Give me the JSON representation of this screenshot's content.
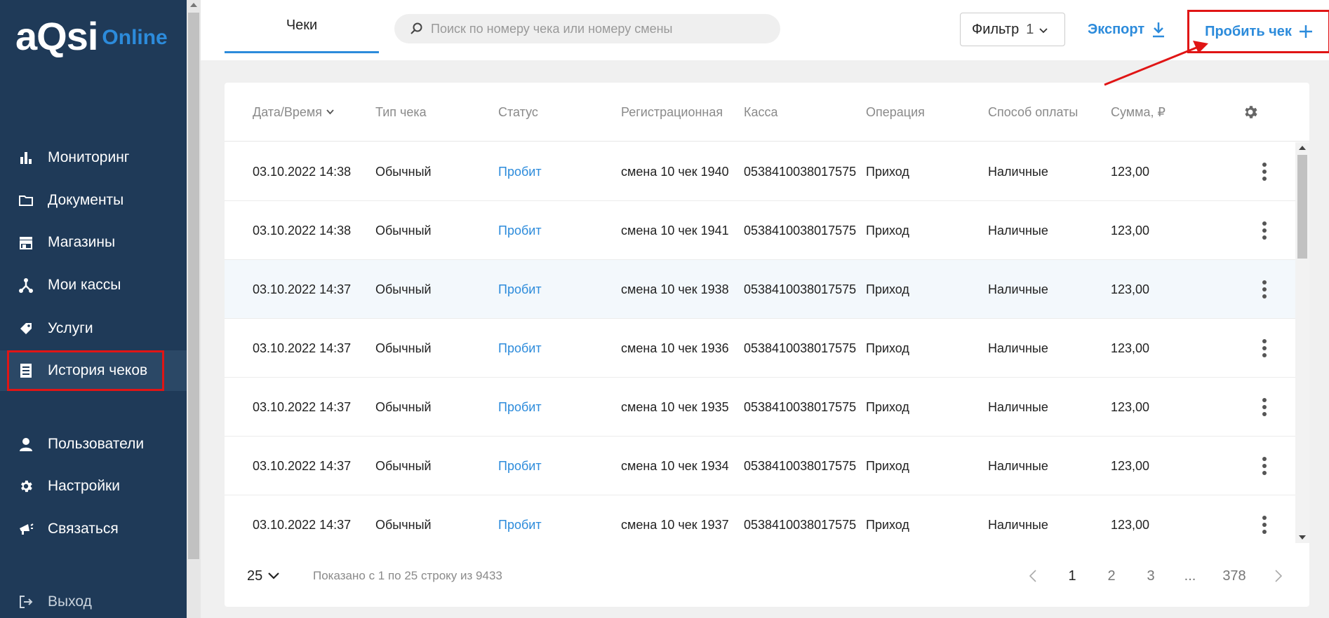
{
  "sidebar": {
    "logo_main": "aQsi",
    "logo_sub": "Online",
    "items": [
      {
        "label": "Мониторинг"
      },
      {
        "label": "Документы"
      },
      {
        "label": "Магазины"
      },
      {
        "label": "Мои кассы"
      },
      {
        "label": "Услуги"
      },
      {
        "label": "История чеков"
      },
      {
        "label": "Пользователи"
      },
      {
        "label": "Настройки"
      },
      {
        "label": "Связаться"
      },
      {
        "label": "Выход"
      }
    ]
  },
  "topbar": {
    "tab_label": "Чеки",
    "search_placeholder": "Поиск по номеру чека или номеру смены",
    "filter_label": "Фильтр",
    "filter_count": "1",
    "export_label": "Экспорт",
    "print_label": "Пробить чек"
  },
  "table": {
    "headers": [
      "Дата/Время",
      "Тип чека",
      "Статус",
      "Регистрационная",
      "Касса",
      "Операция",
      "Способ оплаты",
      "Сумма, ₽"
    ],
    "rows": [
      {
        "datetime": "03.10.2022 14:38",
        "type": "Обычный",
        "status": "Пробит",
        "reg": "смена 10 чек 1940",
        "kassa": "0538410038017575",
        "op": "Приход",
        "pay": "Наличные",
        "sum": "123,00"
      },
      {
        "datetime": "03.10.2022 14:38",
        "type": "Обычный",
        "status": "Пробит",
        "reg": "смена 10 чек 1941",
        "kassa": "0538410038017575",
        "op": "Приход",
        "pay": "Наличные",
        "sum": "123,00"
      },
      {
        "datetime": "03.10.2022 14:37",
        "type": "Обычный",
        "status": "Пробит",
        "reg": "смена 10 чек 1938",
        "kassa": "0538410038017575",
        "op": "Приход",
        "pay": "Наличные",
        "sum": "123,00"
      },
      {
        "datetime": "03.10.2022 14:37",
        "type": "Обычный",
        "status": "Пробит",
        "reg": "смена 10 чек 1936",
        "kassa": "0538410038017575",
        "op": "Приход",
        "pay": "Наличные",
        "sum": "123,00"
      },
      {
        "datetime": "03.10.2022 14:37",
        "type": "Обычный",
        "status": "Пробит",
        "reg": "смена 10 чек 1935",
        "kassa": "0538410038017575",
        "op": "Приход",
        "pay": "Наличные",
        "sum": "123,00"
      },
      {
        "datetime": "03.10.2022 14:37",
        "type": "Обычный",
        "status": "Пробит",
        "reg": "смена 10 чек 1934",
        "kassa": "0538410038017575",
        "op": "Приход",
        "pay": "Наличные",
        "sum": "123,00"
      },
      {
        "datetime": "03.10.2022 14:37",
        "type": "Обычный",
        "status": "Пробит",
        "reg": "смена 10 чек 1937",
        "kassa": "0538410038017575",
        "op": "Приход",
        "pay": "Наличные",
        "sum": "123,00"
      }
    ]
  },
  "footer": {
    "per_page": "25",
    "shown_text": "Показано с 1 по 25 строку из 9433",
    "pages": [
      "1",
      "2",
      "3",
      "...",
      "378"
    ]
  },
  "colors": {
    "sidebar_bg": "#1f3a58",
    "accent": "#2c8bdb",
    "highlight": "#e01515"
  }
}
